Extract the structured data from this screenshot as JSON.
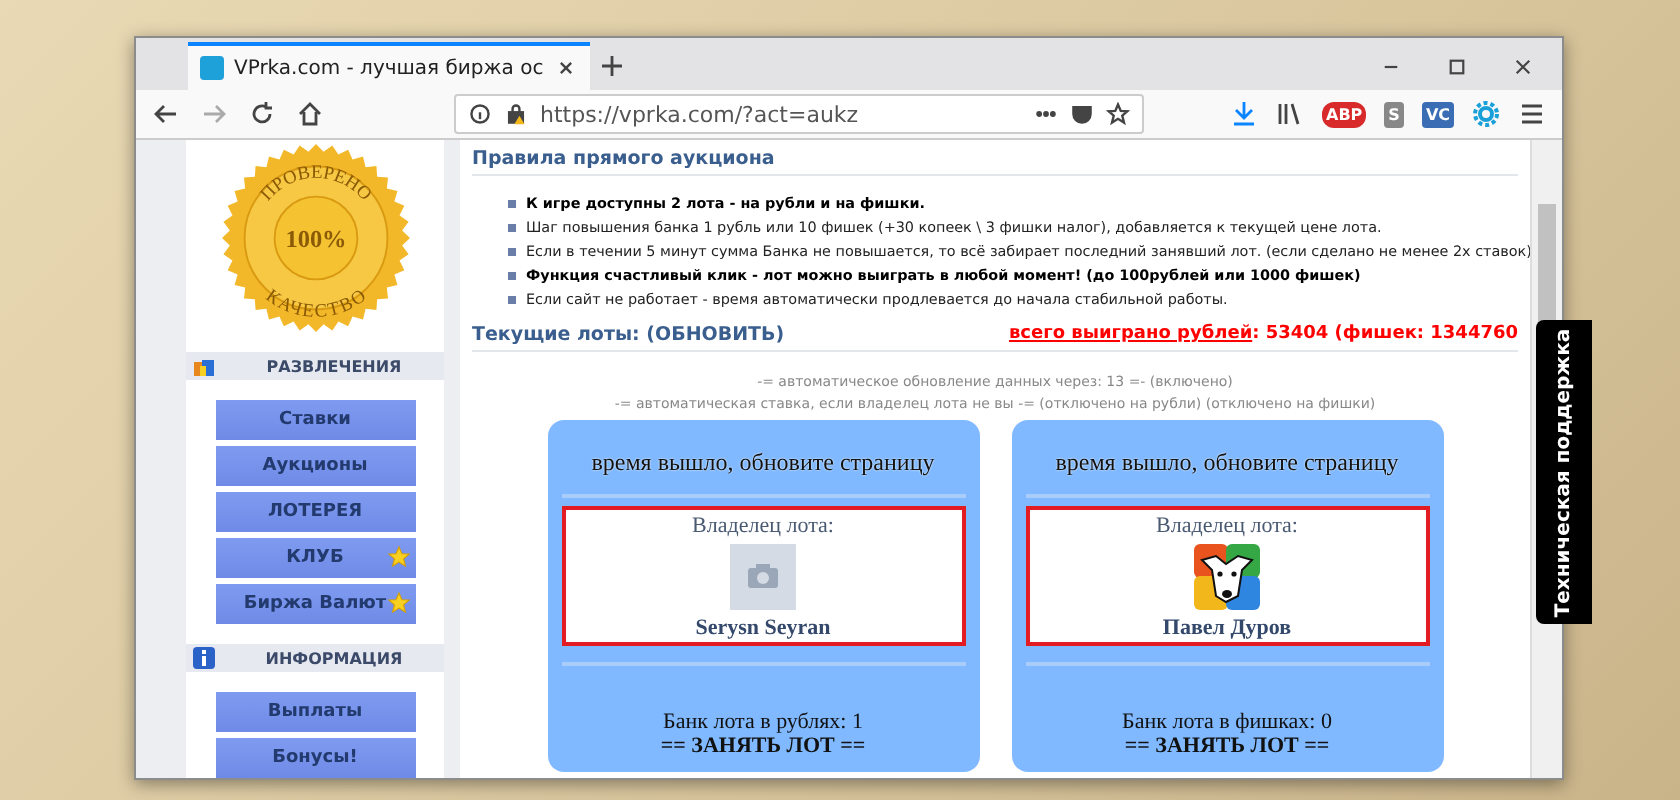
{
  "browser": {
    "tab_title": "VPrka.com - лучшая биржа ос",
    "url": "https://vprka.com/?act=aukz",
    "badges": [
      "ABP",
      "S",
      "VC"
    ]
  },
  "seal": {
    "top": "ПРОВЕРЕНО",
    "center": "100%",
    "bottom": "КАЧЕСТВО"
  },
  "sidebar": [
    {
      "title": "РАЗВЛЕЧЕНИЯ",
      "kind": "games",
      "items": [
        {
          "label": "Ставки",
          "starred": false
        },
        {
          "label": "Аукционы",
          "starred": false
        },
        {
          "label": "ЛОТЕРЕЯ",
          "starred": false
        },
        {
          "label": "КЛУБ",
          "starred": true
        },
        {
          "label": "Биржа Валют",
          "starred": true
        }
      ]
    },
    {
      "title": "ИНФОРМАЦИЯ",
      "kind": "info",
      "items": [
        {
          "label": "Выплаты",
          "starred": false
        },
        {
          "label": "Бонусы!",
          "starred": false
        }
      ]
    }
  ],
  "rules": {
    "title": "Правила прямого аукциона",
    "items": [
      {
        "text": "К игре доступны 2 лота - на рубли и на фишки.",
        "bold": true
      },
      {
        "text": "Шаг повышения банка 1 рубль или 10 фишек (+30 копеек \\ 3 фишки налог), добавляется к текущей цене лота.",
        "bold": false
      },
      {
        "text": "Если в течении 5 минут сумма Банка не повышается, то всё забирает последний занявший лот. (если сделано не менее 2х ставок)",
        "bold": false
      },
      {
        "text": "Функция счастливый клик - лот можно выиграть в любой момент! (до 100рублей или 1000 фишек)",
        "bold": true
      },
      {
        "text": "Если сайт не работает - время автоматически продлевается до начала стабильной работы.",
        "bold": false
      }
    ]
  },
  "lots_header": {
    "title": "Текущие лоты: (ОБНОВИТЬ)",
    "total_link": "всего выиграно рублей",
    "total_value": ": 53404 (фишек: 1344760"
  },
  "notes": [
    "-= автоматическое обновление данных через: 13 =- (включено)",
    "-= автоматическая ставка, если владелец лота не вы -= (отключено на рубли) (отключено на фишки)"
  ],
  "lots": [
    {
      "status": "время вышло, обновите страницу",
      "owner_label": "Владелец лота:",
      "avatar": {
        "kind": "placeholder"
      },
      "owner": "Serysn Seyran",
      "bank": "Банк лота в рублях: 1",
      "action": "== ЗАНЯТЬ ЛОТ =="
    },
    {
      "status": "время вышло, обновите страницу",
      "owner_label": "Владелец лота:",
      "avatar": {
        "kind": "dog"
      },
      "owner": "Павел Дуров",
      "bank": "Банк лота в фишках: 0",
      "action": "== ЗАНЯТЬ ЛОТ =="
    }
  ],
  "support_tab": "Техническая поддержка"
}
